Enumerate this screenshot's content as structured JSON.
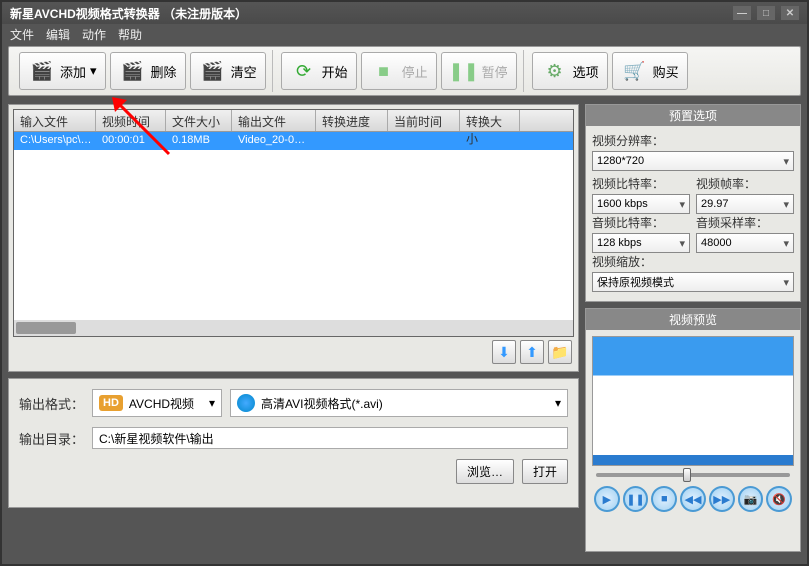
{
  "title": "新星AVCHD视频格式转换器 （未注册版本）",
  "menu": {
    "file": "文件",
    "edit": "编辑",
    "action": "动作",
    "help": "帮助"
  },
  "toolbar": {
    "add": "添加",
    "delete": "删除",
    "clear": "清空",
    "start": "开始",
    "stop": "停止",
    "pause": "暂停",
    "options": "选项",
    "buy": "购买"
  },
  "table": {
    "headers": {
      "input": "输入文件",
      "time": "视频时间",
      "size": "文件大小",
      "output": "输出文件",
      "progress": "转换进度",
      "curtime": "当前时间",
      "csize": "转换大小"
    },
    "row": {
      "input": "C:\\Users\\pc\\…",
      "time": "00:00:01",
      "size": "0.18MB",
      "output": "Video_20-0…",
      "progress": "",
      "curtime": "",
      "csize": ""
    }
  },
  "output": {
    "format_label": "输出格式：",
    "badge": "HD",
    "badge_text": "AVCHD视频",
    "format_value": "高清AVI视频格式(*.avi)",
    "dir_label": "输出目录：",
    "dir_value": "C:\\新星视频软件\\输出",
    "browse": "浏览…",
    "open": "打开"
  },
  "preset": {
    "title": "预置选项",
    "resolution_label": "视频分辨率：",
    "resolution": "1280*720",
    "vbitrate_label": "视频比特率：",
    "vbitrate": "1600 kbps",
    "fps_label": "视频帧率：",
    "fps": "29.97",
    "abitrate_label": "音频比特率：",
    "abitrate": "128 kbps",
    "asample_label": "音频采样率：",
    "asample": "48000",
    "scale_label": "视频缩放：",
    "scale": "保持原视频模式"
  },
  "preview": {
    "title": "视频预览"
  }
}
